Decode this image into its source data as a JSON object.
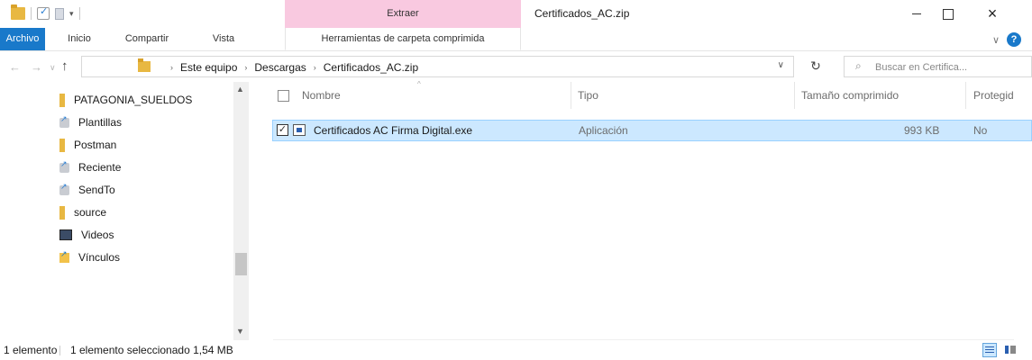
{
  "window": {
    "title": "Certificados_AC.zip",
    "context_tab": "Extraer",
    "close_glyph": "×"
  },
  "ribbon": {
    "tabs": [
      {
        "label": "Archivo"
      },
      {
        "label": "Inicio"
      },
      {
        "label": "Compartir"
      },
      {
        "label": "Vista"
      },
      {
        "label": "Herramientas de carpeta comprimida"
      }
    ],
    "help": "?"
  },
  "address": {
    "crumbs": [
      "Este equipo",
      "Descargas",
      "Certificados_AC.zip"
    ]
  },
  "search": {
    "placeholder": "Buscar en Certifica..."
  },
  "nav_pane": {
    "items": [
      {
        "label": "PATAGONIA_SUELDOS",
        "icon": "folder-icon"
      },
      {
        "label": "Plantillas",
        "icon": "special-folder-icon"
      },
      {
        "label": "Postman",
        "icon": "folder-icon"
      },
      {
        "label": "Reciente",
        "icon": "special-folder-icon"
      },
      {
        "label": "SendTo",
        "icon": "special-folder-icon"
      },
      {
        "label": "source",
        "icon": "folder-icon"
      },
      {
        "label": "Videos",
        "icon": "videos-icon"
      },
      {
        "label": "Vínculos",
        "icon": "links-icon"
      }
    ]
  },
  "file_list": {
    "columns": [
      "Nombre",
      "Tipo",
      "Tamaño comprimido",
      "Protegid"
    ],
    "rows": [
      {
        "name": "Certificados AC Firma Digital.exe",
        "type": "Aplicación",
        "size": "993 KB",
        "protected": "No",
        "selected": true
      }
    ]
  },
  "status": {
    "count": "1 elemento",
    "selection": "1 elemento seleccionado  1,54 MB"
  },
  "colors": {
    "accent": "#1979ca",
    "context_tab": "#f9c9e0",
    "selection": "#cce8ff",
    "folder": "#e8b842"
  }
}
